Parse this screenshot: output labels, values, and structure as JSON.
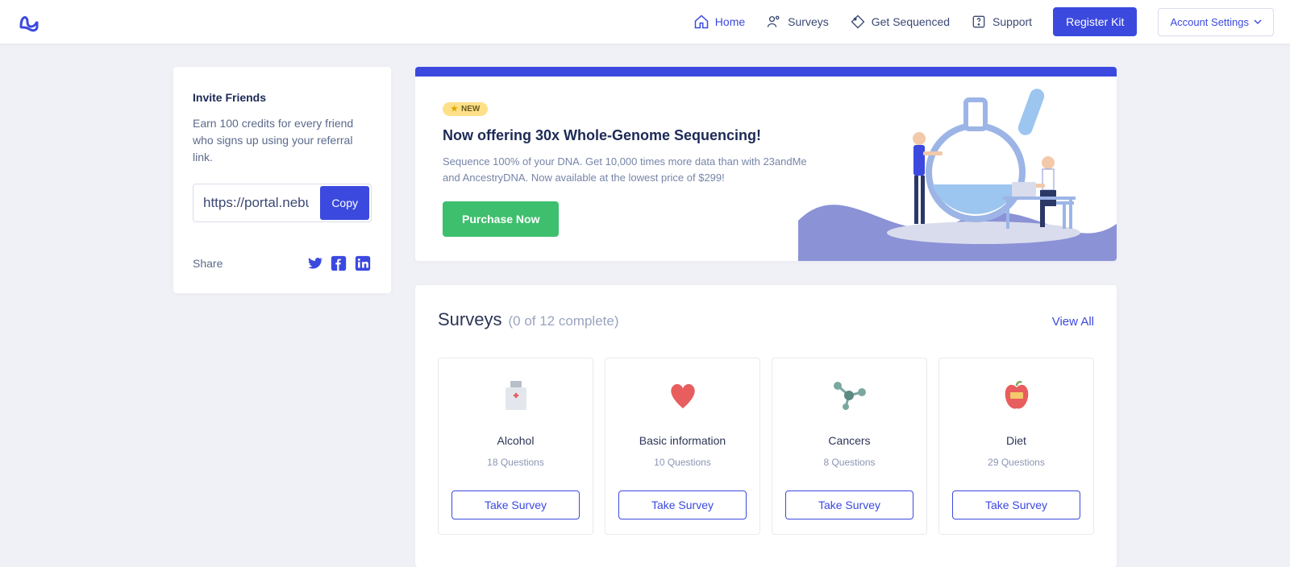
{
  "nav": {
    "home": "Home",
    "surveys": "Surveys",
    "get_sequenced": "Get Sequenced",
    "support": "Support",
    "register_kit": "Register Kit",
    "account_settings": "Account Settings"
  },
  "invite": {
    "title": "Invite Friends",
    "desc": "Earn 100 credits for every friend who signs up using your referral link.",
    "url": "https://portal.nebu",
    "copy": "Copy",
    "share": "Share"
  },
  "banner": {
    "badge": "NEW",
    "title": "Now offering 30x Whole-Genome Sequencing!",
    "desc": "Sequence 100% of your DNA. Get 10,000 times more data than with 23andMe and AncestryDNA. Now available at the lowest price of $299!",
    "cta": "Purchase Now"
  },
  "surveys": {
    "title": "Surveys",
    "count": "(0 of 12 complete)",
    "view_all": "View All",
    "take": "Take Survey",
    "items": [
      {
        "name": "Alcohol",
        "q": "18 Questions"
      },
      {
        "name": "Basic information",
        "q": "10 Questions"
      },
      {
        "name": "Cancers",
        "q": "8 Questions"
      },
      {
        "name": "Diet",
        "q": "29 Questions"
      }
    ]
  }
}
